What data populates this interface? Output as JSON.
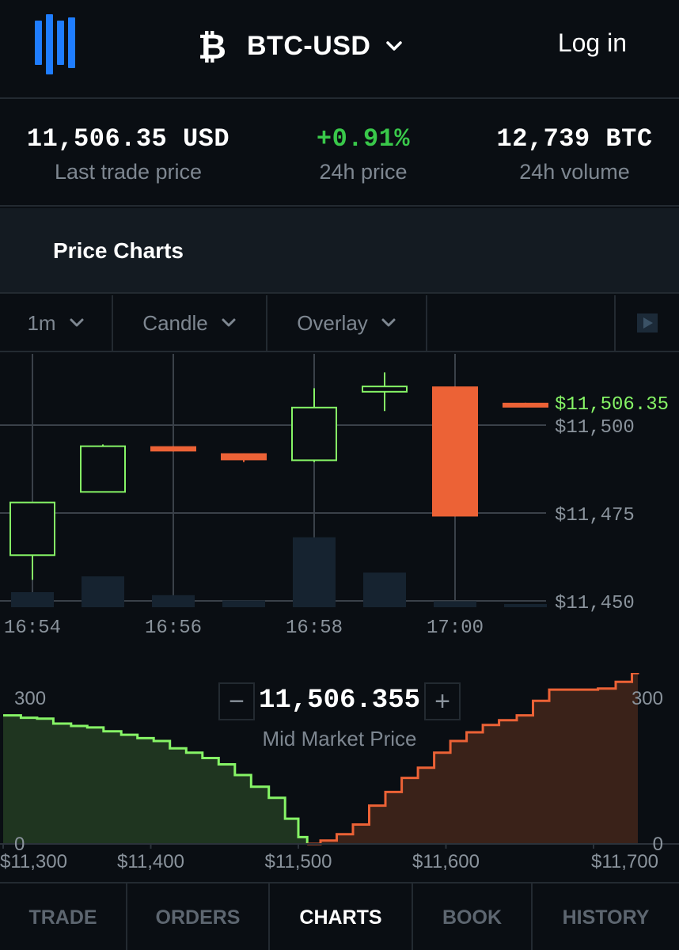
{
  "header": {
    "logo_icon": "bars-logo-icon",
    "coin_icon": "bitcoin-icon",
    "pair": "BTC-USD",
    "pair_icon": "chevron-down-icon",
    "login": "Log in"
  },
  "stats": [
    {
      "value": "11,506.35 USD",
      "label": "Last trade price",
      "color": "#ffffff"
    },
    {
      "value": "+0.91%",
      "label": "24h price",
      "color": "#39c84a"
    },
    {
      "value": "12,739 BTC",
      "label": "24h volume",
      "color": "#ffffff"
    }
  ],
  "section": {
    "title": "Price Charts"
  },
  "toolbar": {
    "interval": "1m",
    "chart_type": "Candle",
    "overlay": "Overlay",
    "play_icon": "play-icon"
  },
  "colors": {
    "up": "#86f466",
    "down": "#ec6236",
    "grid": "#3a4149",
    "axis_text": "#8a939c",
    "volume": "#162330",
    "bid_fill": "#1f3520",
    "ask_fill": "#3a2219"
  },
  "chart_data": [
    {
      "type": "candlestick",
      "current_price_label": "$11,506.35",
      "current_price": 11506.35,
      "y_ticks": [
        {
          "value": 11500,
          "label": "$11,500"
        },
        {
          "value": 11475,
          "label": "$11,475"
        },
        {
          "value": 11450,
          "label": "$11,450"
        }
      ],
      "x_ticks": [
        "16:54",
        "16:56",
        "16:58",
        "17:00"
      ],
      "candles": [
        {
          "open": 11463,
          "close": 11478,
          "high": 11478,
          "low": 11456,
          "direction": "up"
        },
        {
          "open": 11481,
          "close": 11494,
          "high": 11494.5,
          "low": 11481,
          "direction": "up"
        },
        {
          "open": 11494,
          "close": 11492.5,
          "high": 11494,
          "low": 11492.5,
          "direction": "down"
        },
        {
          "open": 11492,
          "close": 11490,
          "high": 11492,
          "low": 11489.5,
          "direction": "down"
        },
        {
          "open": 11490,
          "close": 11505,
          "high": 11510.5,
          "low": 11489.5,
          "direction": "up"
        },
        {
          "open": 11509.5,
          "close": 11511,
          "high": 11515,
          "low": 11504,
          "direction": "up"
        },
        {
          "open": 11511,
          "close": 11474,
          "high": 11511,
          "low": 11474,
          "direction": "down"
        },
        {
          "open": 11506.35,
          "close": 11505.5,
          "high": 11506.35,
          "low": 11505.5,
          "direction": "down"
        }
      ],
      "volumes": [
        0.2,
        0.41,
        0.16,
        0.09,
        0.93,
        0.46,
        0.08,
        0.02
      ]
    },
    {
      "type": "area",
      "title": "Mid Market Price",
      "mid_price": "11,506.355",
      "y_ticks": [
        {
          "value": 300,
          "label": "300"
        },
        {
          "value": 0,
          "label": "0"
        }
      ],
      "x_ticks": [
        {
          "value": 11300,
          "label": "$11,300"
        },
        {
          "value": 11400,
          "label": "$11,400"
        },
        {
          "value": 11500,
          "label": "$11,500"
        },
        {
          "value": 11600,
          "label": "$11,600"
        },
        {
          "value": 11700,
          "label": "$11,700"
        }
      ],
      "xlim": [
        11300,
        11730
      ],
      "series": [
        {
          "side": "bid",
          "points": [
            [
              11300,
              265
            ],
            [
              11312,
              260
            ],
            [
              11323,
              258
            ],
            [
              11334,
              248
            ],
            [
              11346,
              243
            ],
            [
              11357,
              240
            ],
            [
              11368,
              232
            ],
            [
              11380,
              225
            ],
            [
              11391,
              218
            ],
            [
              11402,
              212
            ],
            [
              11413,
              197
            ],
            [
              11424,
              188
            ],
            [
              11435,
              177
            ],
            [
              11446,
              164
            ],
            [
              11457,
              142
            ],
            [
              11468,
              118
            ],
            [
              11480,
              95
            ],
            [
              11491,
              52
            ],
            [
              11500,
              14
            ],
            [
              11506,
              0
            ]
          ]
        },
        {
          "side": "ask",
          "points": [
            [
              11506,
              0
            ],
            [
              11515,
              7
            ],
            [
              11526,
              20
            ],
            [
              11537,
              40
            ],
            [
              11548,
              79
            ],
            [
              11559,
              107
            ],
            [
              11570,
              136
            ],
            [
              11581,
              157
            ],
            [
              11592,
              188
            ],
            [
              11603,
              212
            ],
            [
              11614,
              230
            ],
            [
              11625,
              245
            ],
            [
              11636,
              255
            ],
            [
              11648,
              265
            ],
            [
              11659,
              295
            ],
            [
              11670,
              318
            ],
            [
              11681,
              318
            ],
            [
              11692,
              318
            ],
            [
              11703,
              320
            ],
            [
              11715,
              334
            ],
            [
              11726,
              352
            ],
            [
              11730,
              355
            ]
          ]
        }
      ]
    }
  ],
  "tabs": [
    {
      "label": "TRADE",
      "active": false
    },
    {
      "label": "ORDERS",
      "active": false
    },
    {
      "label": "CHARTS",
      "active": true
    },
    {
      "label": "BOOK",
      "active": false
    },
    {
      "label": "HISTORY",
      "active": false
    }
  ]
}
